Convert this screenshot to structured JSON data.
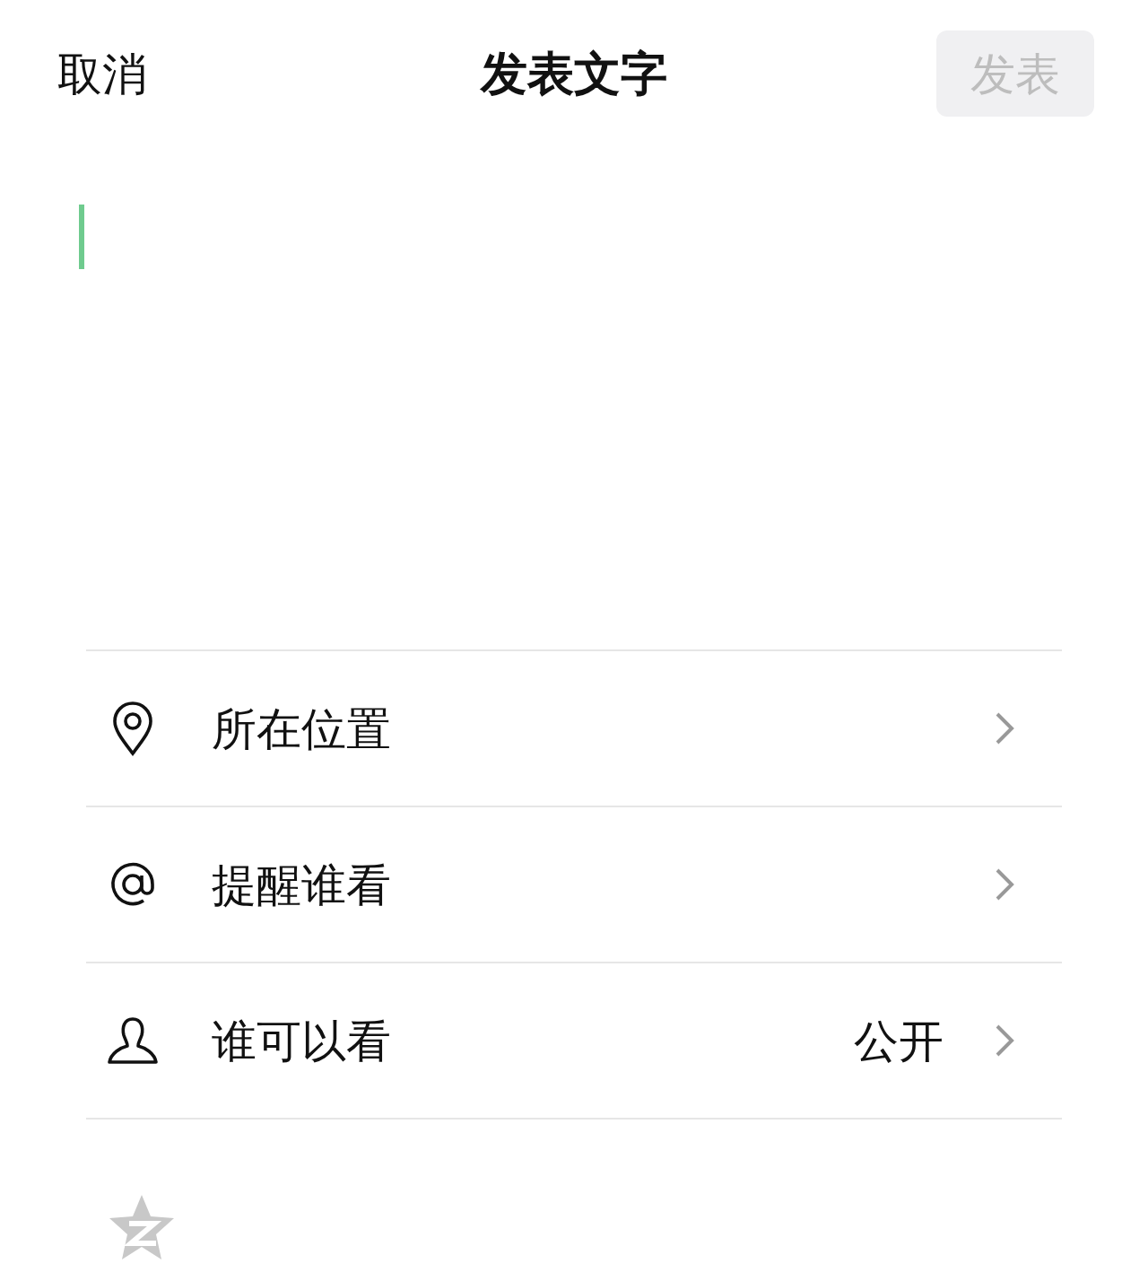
{
  "header": {
    "cancel": "取消",
    "title": "发表文字",
    "publish": {
      "label": "发表",
      "disabled": true
    }
  },
  "options": [
    {
      "kind": "location",
      "label": "所在位置"
    },
    {
      "kind": "mention",
      "label": "提醒谁看"
    },
    {
      "kind": "visibility",
      "label": "谁可以看",
      "value": "公开"
    }
  ]
}
